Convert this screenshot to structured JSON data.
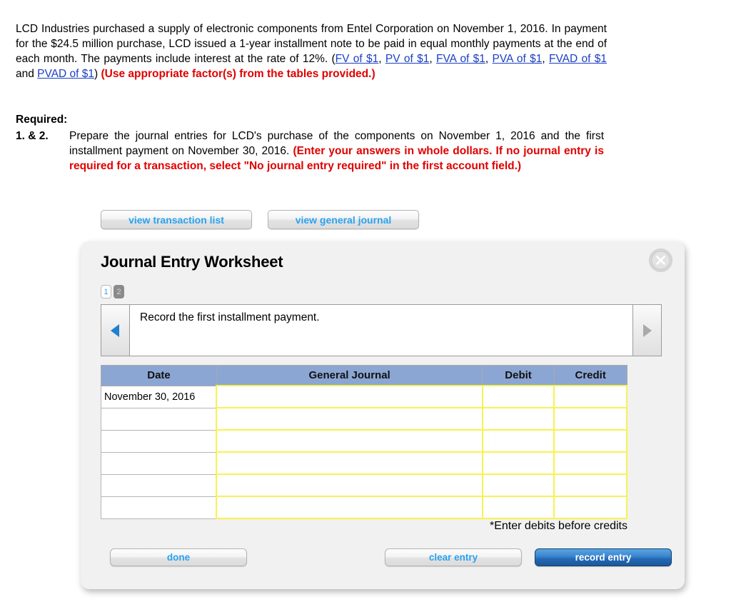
{
  "problem": {
    "part1": "LCD Industries purchased a supply of electronic components from Entel Corporation on November 1, 2016. In payment for the $24.5 million purchase, LCD issued a 1-year installment note to be paid in equal monthly payments at the end of each month. The payments include interest at the rate of 12%. (",
    "links": [
      "FV of $1",
      "PV of $1",
      "FVA of $1",
      "PVA of $1",
      "FVAD of $1",
      "PVAD of $1"
    ],
    "sep_comma": ", ",
    "sep_and": " and ",
    "close_paren": ") ",
    "instruction_red": "(Use appropriate factor(s) from the tables provided.)"
  },
  "required": {
    "heading": "Required:",
    "item_number": "1. & 2.",
    "item_text": "Prepare the journal entries for LCD's purchase of the components on November 1, 2016 and the first installment payment on November 30, 2016. ",
    "item_red": "(Enter your answers in whole dollars. If no journal entry is required for a transaction, select \"No journal entry required\" in the first account field.)"
  },
  "view_buttons": [
    {
      "label": "view transaction list"
    },
    {
      "label": "view general journal"
    }
  ],
  "worksheet": {
    "title": "Journal Entry Worksheet",
    "close_icon": "close-x-icon",
    "tabs": [
      {
        "label": "1",
        "state": "active"
      },
      {
        "label": "2",
        "state": "inactive"
      }
    ],
    "nav": {
      "prev_icon": "triangle-left-icon",
      "next_icon": "triangle-right-icon",
      "prev_color": "#1f7fd0",
      "next_color": "#aaaaaa"
    },
    "prompt": "Record the first installment payment.",
    "table": {
      "headers": [
        "Date",
        "General Journal",
        "Debit",
        "Credit"
      ],
      "header_bg": "#8ca6d4",
      "input_border": "#f7f252",
      "rows": [
        {
          "date": "November 30, 2016",
          "general_journal": "",
          "debit": "",
          "credit": ""
        },
        {
          "date": "",
          "general_journal": "",
          "debit": "",
          "credit": ""
        },
        {
          "date": "",
          "general_journal": "",
          "debit": "",
          "credit": ""
        },
        {
          "date": "",
          "general_journal": "",
          "debit": "",
          "credit": ""
        },
        {
          "date": "",
          "general_journal": "",
          "debit": "",
          "credit": ""
        },
        {
          "date": "",
          "general_journal": "",
          "debit": "",
          "credit": ""
        }
      ]
    },
    "note": "*Enter debits before credits",
    "footer_buttons": {
      "done": "done",
      "clear_entry": "clear entry",
      "record_entry": "record entry"
    }
  },
  "colors": {
    "link": "#1a3fc4",
    "red": "#e00000",
    "button_text": "#2aa3ef",
    "record_entry_bg": "#2267b4"
  }
}
